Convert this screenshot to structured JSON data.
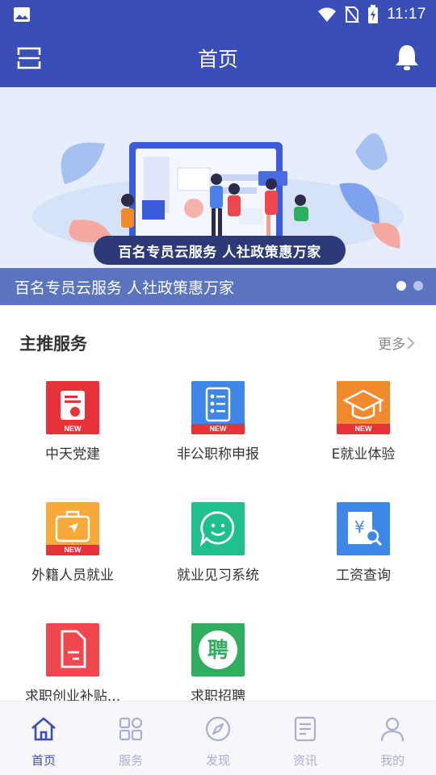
{
  "status_bar": {
    "time": "11:17"
  },
  "header": {
    "title": "首页"
  },
  "banner": {
    "pill_text": "百名专员云服务 人社政策惠万家",
    "caption": "百名专员云服务 人社政策惠万家",
    "slide_count": 2,
    "active_slide": 1
  },
  "section": {
    "title": "主推服务",
    "more_label": "更多"
  },
  "services": [
    {
      "label": "中天党建",
      "icon": "party-building-icon",
      "color": "#e8323a",
      "new_badge": "NEW"
    },
    {
      "label": "非公职称申报",
      "icon": "checklist-icon",
      "color": "#3f87e6",
      "new_badge": "NEW"
    },
    {
      "label": "E就业体验",
      "icon": "graduation-cap-icon",
      "color": "#f08a2c",
      "new_badge": "NEW"
    },
    {
      "label": "外籍人员就业",
      "icon": "briefcase-icon",
      "color": "#f7a93a",
      "new_badge": "NEW"
    },
    {
      "label": "就业见习系统",
      "icon": "chat-smile-icon",
      "color": "#1fbf8f",
      "new_badge": ""
    },
    {
      "label": "工资查询",
      "icon": "salary-search-icon",
      "color": "#3f87e6",
      "new_badge": ""
    },
    {
      "label": "求职创业补贴...",
      "icon": "document-icon",
      "color": "#f0474f",
      "new_badge": ""
    },
    {
      "label": "求职招聘",
      "icon": "recruit-icon",
      "color": "#2fae5f",
      "new_badge": ""
    }
  ],
  "recruit_glyph": "聘",
  "salary_glyph": "¥",
  "tabs": [
    {
      "label": "首页",
      "icon": "home-icon",
      "active": true
    },
    {
      "label": "服务",
      "icon": "grid-icon",
      "active": false
    },
    {
      "label": "发现",
      "icon": "compass-icon",
      "active": false
    },
    {
      "label": "资讯",
      "icon": "news-icon",
      "active": false
    },
    {
      "label": "我的",
      "icon": "profile-icon",
      "active": false
    }
  ],
  "colors": {
    "brand": "#3a4eb8",
    "tab_inactive": "#a9aece",
    "banner_bg": "#e6edfb"
  }
}
